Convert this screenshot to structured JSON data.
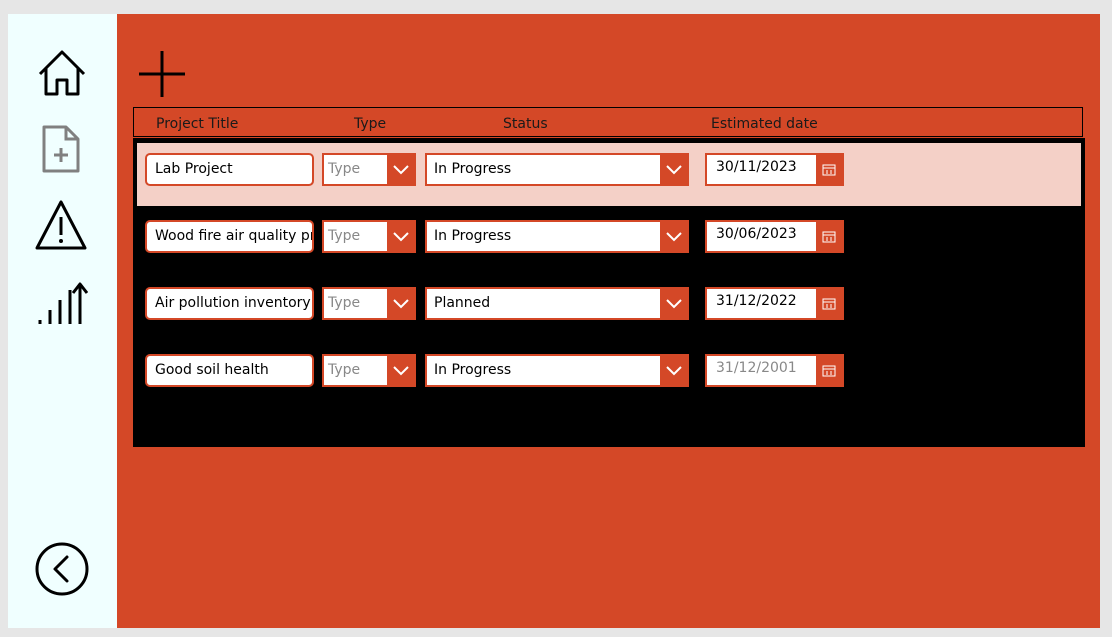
{
  "header": {
    "col_title": "Project Title",
    "col_type": "Type",
    "col_status": "Status",
    "col_date": "Estimated date"
  },
  "rows": [
    {
      "title": "Lab Project",
      "type": "Type",
      "status": "In Progress",
      "date": "30/11/2023",
      "selected": true
    },
    {
      "title": "Wood fire air quality project",
      "type": "Type",
      "status": "In Progress",
      "date": "30/06/2023"
    },
    {
      "title": "Air pollution inventory project",
      "type": "Type",
      "status": "Planned",
      "date": "31/12/2022"
    },
    {
      "title": "Good soil health",
      "type": "Type",
      "status": "In Progress",
      "date": "31/12/2001",
      "date_placeholder": true
    }
  ],
  "colors": {
    "accent": "#d44827",
    "sidebar": "#f0ffff",
    "selected_row": "#f4d0c7",
    "gallery": "#000000"
  },
  "icons": [
    "home-icon",
    "new-document-icon",
    "warning-icon",
    "chart-bars-icon",
    "back-arrow-icon",
    "add-icon",
    "chevron-down-icon",
    "calendar-icon"
  ]
}
